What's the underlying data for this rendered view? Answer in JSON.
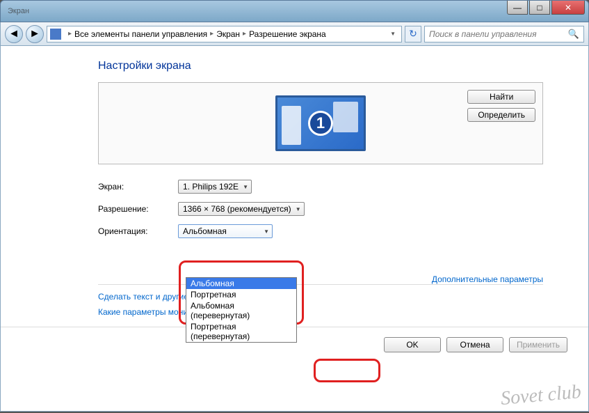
{
  "window": {
    "title": "Экран"
  },
  "breadcrumb": {
    "root": "Все элементы панели управления",
    "mid": "Экран",
    "leaf": "Разрешение экрана"
  },
  "search": {
    "placeholder": "Поиск в панели управления"
  },
  "page": {
    "title": "Настройки экрана"
  },
  "preview": {
    "monitor_number": "1",
    "find_btn": "Найти",
    "detect_btn": "Определить"
  },
  "form": {
    "display_label": "Экран:",
    "display_value": "1. Philips 192E",
    "resolution_label": "Разрешение:",
    "resolution_value": "1366 × 768 (рекомендуется)",
    "orientation_label": "Ориентация:",
    "orientation_value": "Альбомная",
    "orientation_options": [
      "Альбомная",
      "Портретная",
      "Альбомная (перевернутая)",
      "Портретная (перевернутая)"
    ]
  },
  "links": {
    "advanced": "Дополнительные параметры",
    "text_size": "Сделать текст и другие",
    "which_monitor": "Какие параметры монитора следует выбрать?"
  },
  "buttons": {
    "ok": "OK",
    "cancel": "Отмена",
    "apply": "Применить"
  },
  "watermark": "Sovet club"
}
